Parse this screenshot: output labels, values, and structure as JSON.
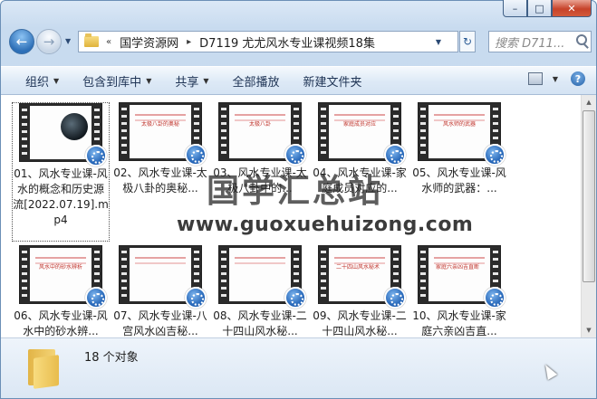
{
  "window": {
    "min_label": "–",
    "max_label": "□",
    "close_label": "✕"
  },
  "nav": {
    "back_glyph": "←",
    "forward_glyph": "→",
    "drop_glyph": "▼",
    "breadcrumbs": [
      "«",
      "国学资源网",
      "▸",
      "D7119 尤尤风水专业课视频18集"
    ],
    "refresh_glyph": "↻",
    "search_placeholder": "搜索 D711..."
  },
  "toolbar": {
    "organize": "组织",
    "include_library": "包含到库中",
    "share": "共享",
    "play_all": "全部播放",
    "new_folder": "新建文件夹",
    "arrow": "▼",
    "help": "?"
  },
  "files": [
    {
      "label": "01、风水专业课-风水的概念和历史源流[2022.07.19].mp4",
      "thumb_text": "",
      "selected": true
    },
    {
      "label": "02、风水专业课-太极八卦的奥秘...",
      "thumb_text": "太极八卦的奥秘"
    },
    {
      "label": "03、风水专业课-太极八卦中的...",
      "thumb_text": "太极八卦"
    },
    {
      "label": "04、风水专业课-家庭成员对应的...",
      "thumb_text": "家庭成员对应"
    },
    {
      "label": "05、风水专业课-风水师的武器：...",
      "thumb_text": "风水师的武器"
    },
    {
      "label": "06、风水专业课-风水中的砂水辨...",
      "thumb_text": "风水中的砂水辨析"
    },
    {
      "label": "07、风水专业课-八宫风水凶吉秘...",
      "thumb_text": ""
    },
    {
      "label": "08、风水专业课-二十四山风水秘...",
      "thumb_text": ""
    },
    {
      "label": "09、风水专业课-二十四山风水秘...",
      "thumb_text": "二十四山风水秘术（秘传）"
    },
    {
      "label": "10、风水专业课-家庭六亲凶吉直...",
      "thumb_text": "家庭六亲凶吉直断（秘传）"
    }
  ],
  "watermark": {
    "title": "国学汇总站",
    "url": "www.guoxuehuizong.com"
  },
  "details": {
    "count": "18 个对象"
  }
}
